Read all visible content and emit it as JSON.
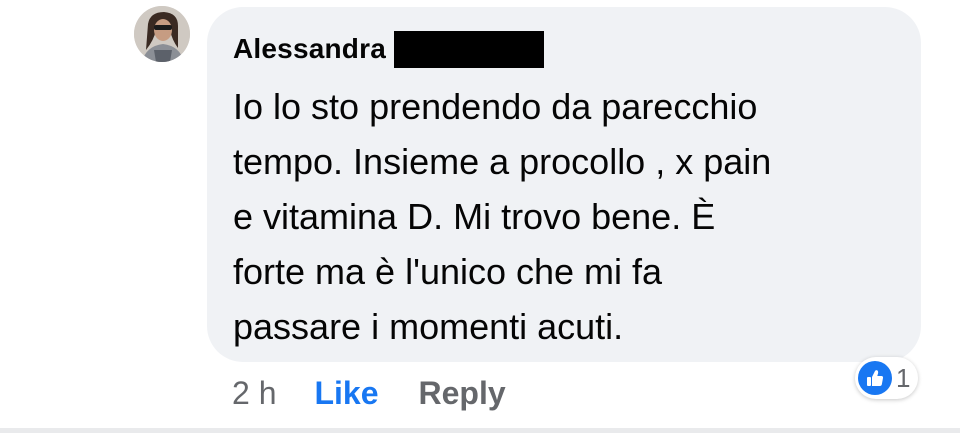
{
  "comment": {
    "author": "Alessandra",
    "author_last_name_redacted": true,
    "text": "Io lo sto prendendo da parecchio\ntempo. Insieme a procollo , x pain\ne vitamina D. Mi trovo bene. È\nforte ma è l'unico che mi fa\npassare i momenti acuti."
  },
  "actions": {
    "timestamp": "2 h",
    "like_label": "Like",
    "reply_label": "Reply"
  },
  "reactions": {
    "icon": "thumbs-up-icon",
    "count": "1"
  },
  "colors": {
    "bubble_bg": "#f0f2f5",
    "like_blue": "#1877f2",
    "secondary_text": "#65676b",
    "primary_text": "#050505"
  }
}
